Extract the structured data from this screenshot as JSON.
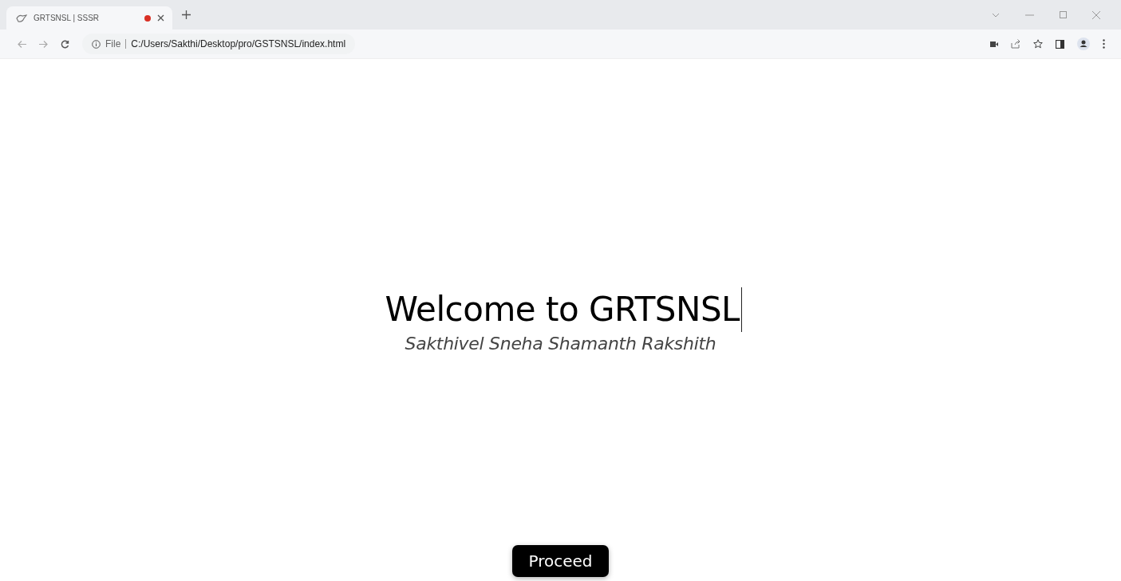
{
  "browser": {
    "tab": {
      "title": "GRTSNSL | SSSR",
      "selected": true
    },
    "address": {
      "scheme": "File",
      "url": "C:/Users/Sakthi/Desktop/pro/GSTSNSL/index.html"
    }
  },
  "page": {
    "heading": "Welcome to GRTSNSL",
    "subtitle": "Sakthivel Sneha Shamanth Rakshith",
    "button": "Proceed"
  }
}
